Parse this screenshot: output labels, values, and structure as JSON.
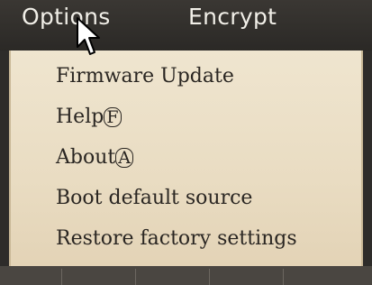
{
  "menubar": {
    "items": [
      {
        "label": "Options"
      },
      {
        "label": "Encrypt"
      }
    ]
  },
  "dropdown": {
    "items": [
      {
        "text": "Firmware Update",
        "mnemonic": ""
      },
      {
        "text": "Help",
        "mnemonic": "F"
      },
      {
        "text": "About",
        "mnemonic": "A"
      },
      {
        "text": "Boot default source",
        "mnemonic": ""
      },
      {
        "text": "Restore factory settings",
        "mnemonic": ""
      }
    ]
  },
  "colors": {
    "menubar_bg": "#2e2c2a",
    "menubar_text": "#f1efe8",
    "dropdown_bg": "#ece1ca",
    "item_text": "#2a2622"
  },
  "icons": [
    "mouse-pointer-icon"
  ]
}
